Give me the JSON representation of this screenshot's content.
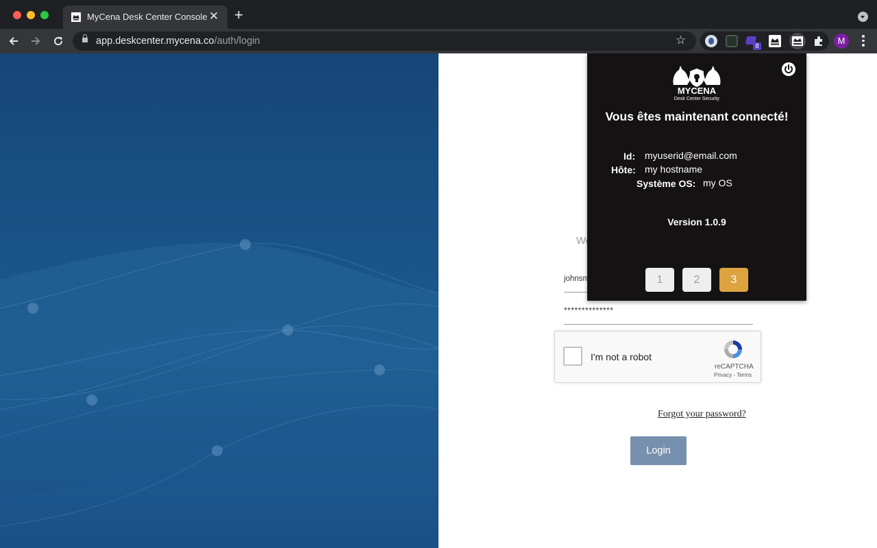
{
  "browser": {
    "tab_title": "MyCena Desk Center Console",
    "tab_close": "✕",
    "new_tab": "+",
    "url_host": "app.deskcenter.mycena.co",
    "url_path": "/auth/login",
    "profile_initial": "M",
    "extension_badge": "8"
  },
  "login": {
    "welcome_partial": "We",
    "username_value": "johnsm",
    "password_value": "**************",
    "recaptcha_label": "I'm not a robot",
    "recaptcha_brand": "reCAPTCHA",
    "recaptcha_terms": "Privacy - Terms",
    "forgot_password": "Forgot your password?",
    "login_button": "Login",
    "login_button_color": "#7790ad"
  },
  "popup": {
    "logo_name": "MYCENA",
    "logo_subtitle": "Desk Center Security",
    "title": "Vous êtes maintenant connecté!",
    "id_label": "Id:",
    "id_value": "myuserid@email.com",
    "host_label": "Hôte:",
    "host_value": "my hostname",
    "os_label": "Système OS:",
    "os_value": "my OS",
    "version": "Version 1.0.9",
    "pages": [
      "1",
      "2",
      "3"
    ],
    "active_page": "3",
    "active_color": "#dca33f"
  },
  "colors": {
    "chrome_dark": "#1f2023",
    "chrome_toolbar": "#35363a",
    "left_panel": "#1a5285",
    "popup_bg": "#151213"
  }
}
